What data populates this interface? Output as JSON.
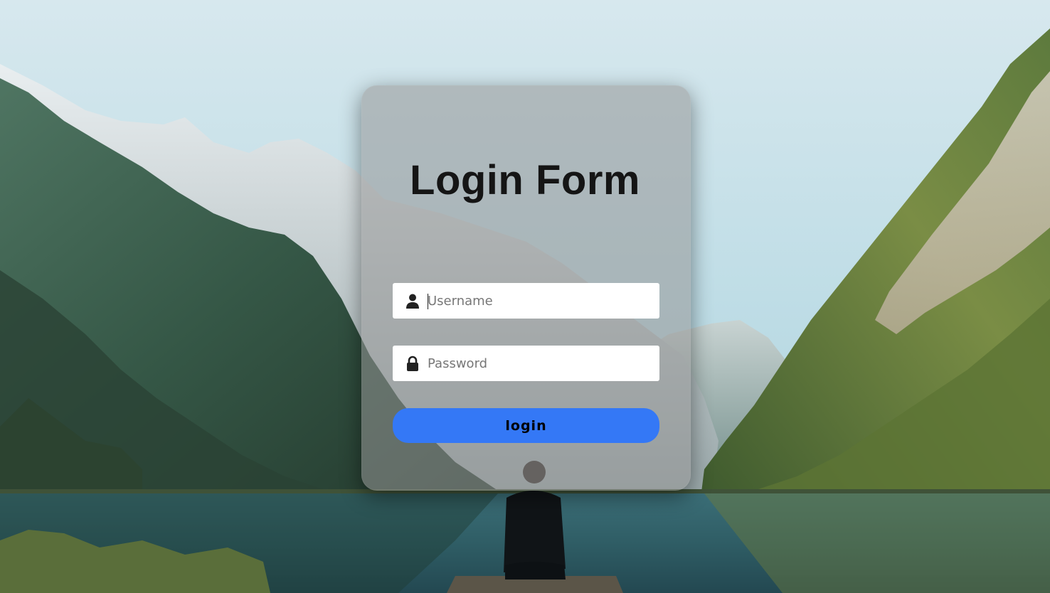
{
  "title": "Login Form",
  "username": {
    "placeholder": "Username",
    "icon": "user-icon"
  },
  "password": {
    "placeholder": "Password",
    "icon": "lock-icon"
  },
  "login_button": {
    "label": "login"
  },
  "colors": {
    "button": "#3478f6",
    "card_overlay": "rgba(150,150,150,0.55)",
    "title_text": "#151515"
  }
}
